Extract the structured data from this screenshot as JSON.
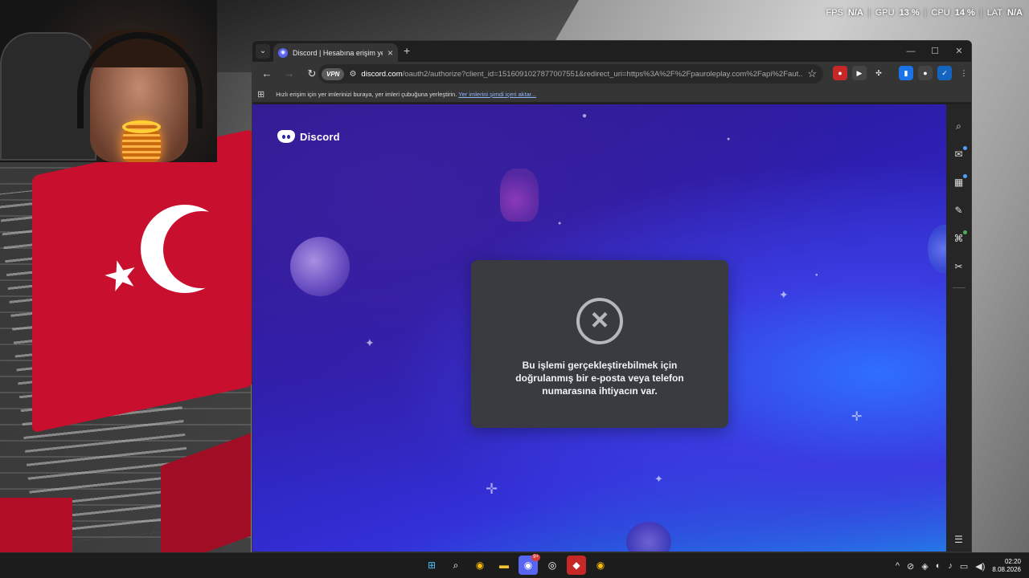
{
  "overlay": {
    "fps_label": "FPS",
    "fps_value": "N/A",
    "gpu_label": "GPU",
    "gpu_value": "13 %",
    "cpu_label": "CPU",
    "cpu_value": "14 %",
    "lat_label": "LAT",
    "lat_value": "N/A",
    "separator": "|"
  },
  "browser": {
    "tab_title": "Discord | Hesabına erişim yetkis",
    "tab_favicon": "discord-icon",
    "url_domain": "discord.com",
    "url_path": "/oauth2/authorize?client_id=1516091027877007551&redirect_uri=https%3A%2F%2Fpauroleplay.com%2Fapi%2Faut...",
    "vpn_label": "VPN",
    "bookmarks_text": "Hızlı erişim için yer imlerinizi buraya, yer imleri çubuğuna yerleştirin.",
    "bookmarks_link": "Yer imlerini şimdi içeri aktar...",
    "window_controls": [
      "—",
      "☐",
      "✕"
    ]
  },
  "page": {
    "brand_name": "Discord",
    "error_message": "Bu işlemi gerçekleştirebilmek için doğrulanmış bir e-posta veya telefon numarasına ihtiyacın var."
  },
  "taskbar": {
    "discord_badge": "9+",
    "time": "02:20",
    "date": "8.08.2026"
  },
  "colors": {
    "discord_blurple": "#5865f2",
    "modal_bg": "#393b41",
    "link_blue": "#8ab4f8",
    "flag_red": "#c8102e"
  }
}
